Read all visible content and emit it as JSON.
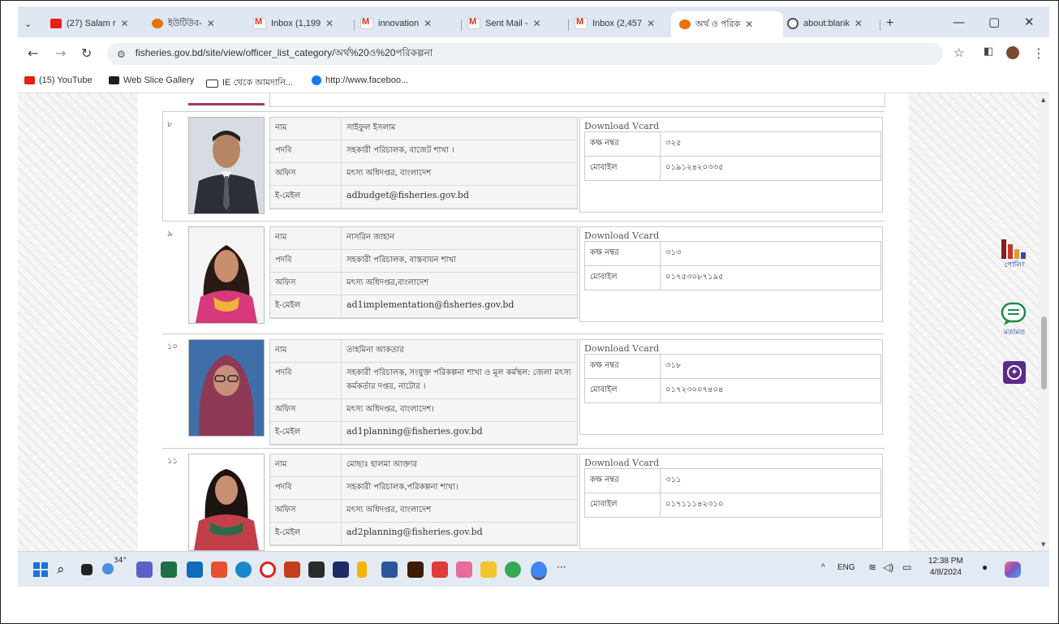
{
  "tabs": [
    {
      "label": "(27) Salam r",
      "icon": "youtube-icon"
    },
    {
      "label": "ইউটিউব-",
      "icon": "globe-icon"
    },
    {
      "label": "Inbox (1,199",
      "icon": "gmail-icon"
    },
    {
      "label": "innovation",
      "icon": "gmail-icon"
    },
    {
      "label": "Sent Mail -",
      "icon": "gmail-icon"
    },
    {
      "label": "Inbox (2,457",
      "icon": "gmail-icon"
    },
    {
      "label": "অর্থ ও পরিক",
      "icon": "site-icon"
    },
    {
      "label": "about:blank",
      "icon": "globe-icon"
    }
  ],
  "window": {
    "minimize": "—",
    "restore": "▢",
    "close": "✕",
    "new_tab": "+",
    "tab_list": "⌄"
  },
  "address": {
    "url": "fisheries.gov.bd/site/view/officer_list_category/অর্থ%20ও%20পরিকল্পনা"
  },
  "bookmarks": [
    {
      "label": "(15) YouTube",
      "icon": "youtube-icon",
      "color": "#e62117"
    },
    {
      "label": "Web Slice Gallery",
      "icon": "web-slice-icon",
      "color": "#1f1f1f"
    },
    {
      "label": "IE থেকে আমদানি...",
      "icon": "folder-icon",
      "color": "#333333"
    },
    {
      "label": "http://www.faceboo...",
      "icon": "facebook-icon",
      "color": "#1877f2"
    }
  ],
  "officers": [
    {
      "serial": "৮",
      "name_label": "নাম",
      "name": "সাইফুল ইসলাম",
      "designation_label": "পদবি",
      "designation": "সহকারী পরিচালক, বাজেট শাখা ।",
      "office_label": "অফিস",
      "office": "মৎস্য অধিদপ্তর, বাংলাদেশ",
      "email_label": "ই-মেইল",
      "email": "adbudget@fisheries.gov.bd",
      "vcard_title": "Download Vcard",
      "room_label": "কক্ষ নম্বর",
      "room": "৩২৫",
      "mobile_label": "মোবাইল",
      "mobile": "০১৯১২৪২০৩৩৫",
      "photo_bg": "#cfd6dc",
      "attire": "#2b2f36"
    },
    {
      "serial": "৯",
      "name_label": "নাম",
      "name": "নাসরিন জাহান",
      "designation_label": "পদবি",
      "designation": "সহকারী পরিচালক, বাস্তবায়ন শাখা",
      "office_label": "অফিস",
      "office": "মৎস্য অধিদপ্তর,বাংলাদেশ",
      "email_label": "ই-মেইল",
      "email": "ad1implementation@fisheries.gov.bd",
      "vcard_title": "Download Vcard",
      "room_label": "কক্ষ নম্বর",
      "room": "৩১৩",
      "mobile_label": "মোবাইল",
      "mobile": "০১৭৫৩০৮৭১৯৫",
      "photo_bg": "#f4f4f4",
      "attire": "#d8397a"
    },
    {
      "serial": "১০",
      "name_label": "নাম",
      "name": "তাহমিনা আকতার",
      "designation_label": "পদবি",
      "designation": "সহকারী পরিচালক, সংযুক্ত পরিকল্পনা শাখা ও মূল কর্মস্থল: জেলা মৎস্য কর্মকর্তার দপ্তর, নাটোর ।",
      "office_label": "অফিস",
      "office": "মৎস্য অধিদপ্তর, বাংলাদেশ।",
      "email_label": "ই-মেইল",
      "email": "ad1planning@fisheries.gov.bd",
      "vcard_title": "Download Vcard",
      "room_label": "কক্ষ নম্বর",
      "room": "৩১৮",
      "mobile_label": "মোবাইল",
      "mobile": "০১৭২৩০০৭৪০৪",
      "photo_bg": "#3f6fa8",
      "attire": "#8e3a57"
    },
    {
      "serial": "১১",
      "name_label": "নাম",
      "name": "মোছাঃ হালমা আক্তার",
      "designation_label": "পদবি",
      "designation": "সহকারী পরিচালক,পরিকল্পনা শাখা।",
      "office_label": "অফিস",
      "office": "মৎস্য অধিদপ্তর, বাংলাদেশ",
      "email_label": "ই-মেইল",
      "email": "ad2planning@fisheries.gov.bd",
      "vcard_title": "Download Vcard",
      "room_label": "কক্ষ নম্বর",
      "room": "৩১১",
      "mobile_label": "মোবাইল",
      "mobile": "০১৭১১১৪২৩১০",
      "photo_bg": "#ffffff",
      "attire": "#c2404a"
    }
  ],
  "side_widgets": {
    "poll_label": "পোলিং",
    "feedback_label": "মতামত"
  },
  "taskbar": {
    "weather": "34°",
    "lang": "ENG",
    "time": "12:38 PM",
    "date": "4/8/2024",
    "more": "···",
    "up_arrow": "^"
  }
}
